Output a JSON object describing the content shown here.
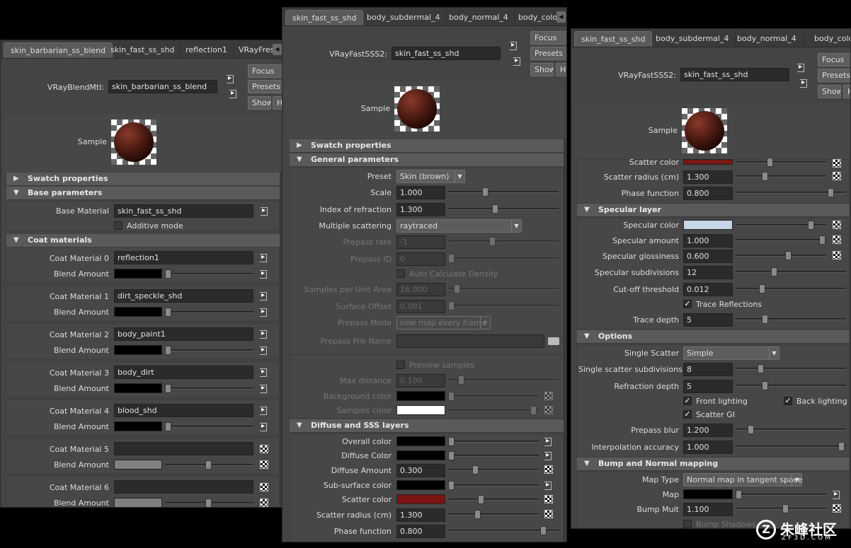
{
  "w1": {
    "tabs": [
      "skin_barbarian_ss_blend",
      "skin_fast_ss_shd",
      "reflection1",
      "VRayFresn"
    ],
    "type_label": "VRayBlendMtl:",
    "name_value": "skin_barbarian_ss_blend",
    "btn_focus": "Focus",
    "btn_presets": "Presets",
    "btn_show": "Show",
    "btn_hide": "Hi",
    "sample_label": "Sample",
    "sec_swatch": "Swatch properties",
    "sec_base": "Base parameters",
    "base_label": "Base Material",
    "base_value": "skin_fast_ss_shd",
    "additive": "Additive mode",
    "sec_coat": "Coat materials",
    "coats": [
      {
        "label": "Coat Material 0",
        "value": "reflection1",
        "blend": "Blend Amount"
      },
      {
        "label": "Coat Material 1",
        "value": "dirt_speckle_shd",
        "blend": "Blend Amount"
      },
      {
        "label": "Coat Material 2",
        "value": "body_paint1",
        "blend": "Blend Amount"
      },
      {
        "label": "Coat Material 3",
        "value": "body_dirt",
        "blend": "Blend Amount"
      },
      {
        "label": "Coat Material 4",
        "value": "blood_shd",
        "blend": "Blend Amount"
      },
      {
        "label": "Coat Material 5",
        "value": "",
        "blend": "Blend Amount"
      },
      {
        "label": "Coat Material 6",
        "value": "",
        "blend": "Blend Amount"
      }
    ]
  },
  "w2": {
    "tabs": [
      "skin_fast_ss_shd",
      "body_subdermal_4",
      "body_normal_4",
      "body_color"
    ],
    "type_label": "VRayFastSSS2:",
    "name_value": "skin_fast_ss_shd",
    "btn_focus": "Focus",
    "btn_presets": "Presets",
    "btn_show": "Show",
    "btn_hide": "Hi",
    "sample_label": "Sample",
    "sec_swatch": "Swatch properties",
    "sec_general": "General parameters",
    "preset_label": "Preset",
    "preset_value": "Skin (brown)",
    "scale_label": "Scale",
    "scale_value": "1.000",
    "ior_label": "Index of refraction",
    "ior_value": "1.300",
    "ms_label": "Multiple scattering",
    "ms_value": "raytraced",
    "prepass_rate_label": "Prepass rate",
    "prepass_rate_value": "-1",
    "prepass_id_label": "Prepass ID",
    "prepass_id_value": "0",
    "auto_calc": "Auto Calculate Density",
    "spua_label": "Samples per Unit Area",
    "spua_value": "16.000",
    "so_label": "Surface Offset",
    "so_value": "0.001",
    "pm_label": "Prepass Mode",
    "pm_value": "new map every frame",
    "pfn_label": "Prepass File Name",
    "preview": "Preview samples",
    "maxd_label": "Max distance",
    "maxd_value": "0.100",
    "bg_label": "Background color",
    "sc_label": "Samples color",
    "sec_diffuse": "Diffuse and SSS layers",
    "overall_label": "Overall color",
    "diffuse_label": "Diffuse Color",
    "da_label": "Diffuse Amount",
    "da_value": "0.300",
    "ssc_label": "Sub-surface color",
    "scatter_label": "Scatter color",
    "sr_label": "Scatter radius (cm)",
    "sr_value": "1.300",
    "pf_label": "Phase function",
    "pf_value": "0.800"
  },
  "w3": {
    "tabs": [
      "skin_fast_ss_shd",
      "body_subdermal_4",
      "body_normal_4",
      "body_color"
    ],
    "type_label": "VRayFastSSS2:",
    "name_value": "skin_fast_ss_shd",
    "btn_focus": "Focus",
    "btn_presets": "Presets",
    "btn_show": "Show",
    "btn_hide": "Hi",
    "sample_label": "Sample",
    "scatter_label": "Scatter color",
    "sr_label": "Scatter radius (cm)",
    "sr_value": "1.300",
    "pf_label": "Phase function",
    "pf_value": "0.800",
    "sec_spec": "Specular layer",
    "spc_label": "Specular color",
    "spa_label": "Specular amount",
    "spa_value": "1.000",
    "spg_label": "Specular glossiness",
    "spg_value": "0.600",
    "sps_label": "Specular subdivisions",
    "sps_value": "12",
    "cot_label": "Cut-off threshold",
    "cot_value": "0.012",
    "trace_refl": "Trace Reflections",
    "td_label": "Trace depth",
    "td_value": "5",
    "sec_options": "Options",
    "ss_label": "Single Scatter",
    "ss_value": "Simple",
    "sss_label": "Single scatter subdivisions",
    "sss_value": "8",
    "rd_label": "Refraction depth",
    "rd_value": "5",
    "front": "Front lighting",
    "back": "Back lighting",
    "sgi": "Scatter GI",
    "pb_label": "Prepass blur",
    "pb_value": "1.200",
    "ia_label": "Interpolation accuracy",
    "ia_value": "1.000",
    "sec_bump": "Bump and Normal mapping",
    "mt_label": "Map Type",
    "mt_value": "Normal map in tangent space",
    "map_label": "Map",
    "bm_label": "Bump Mult",
    "bm_value": "1.100",
    "bs": "Bump Shadows"
  },
  "watermark": "朱峰社区",
  "watermark_url": "ZF3D.COM",
  "colors": {
    "scatter": "#7a1512",
    "specular": "#c7d6e6",
    "black": "#000000",
    "white": "#ffffff",
    "blend_gray": "#808080"
  }
}
